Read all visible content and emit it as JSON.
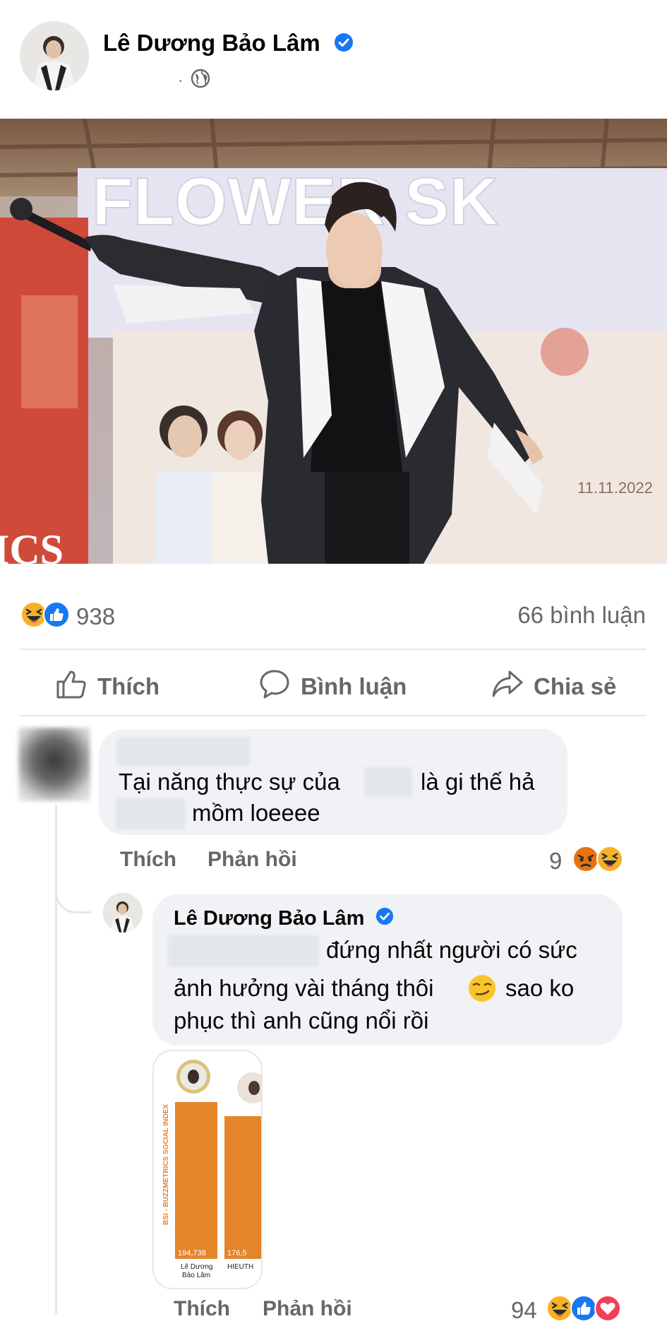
{
  "post": {
    "author": "Lê Dương Bảo Lâm",
    "meta_dot": "·",
    "photo_banner_text": "FLOWER SK",
    "photo_date_text": "11.11.2022",
    "photo_side_text": "ICS"
  },
  "stats": {
    "reaction_count": "938",
    "comment_count": "66 bình luận"
  },
  "actions": {
    "like": "Thích",
    "comment": "Bình luận",
    "share": "Chia sẻ"
  },
  "comment1": {
    "line1_a": "Tại năng thực sự của",
    "line1_b": "là gi thế hả",
    "line2": "mồm loeeee",
    "like_label": "Thích",
    "reply_label": "Phản hồi",
    "reaction_count": "9"
  },
  "reply": {
    "author": "Lê Dương Bảo Lâm",
    "line1": "đứng nhất người có sức",
    "line2_a": "ảnh hưởng vài tháng thôi",
    "line2_b": "sao ko",
    "line3": "phục thì anh cũng nổi rồi",
    "like_label": "Thích",
    "reply_label": "Phản hồi",
    "reaction_count": "94"
  },
  "attachment": {
    "axis_label": "BSI - BUZZMETRICS SOCIAL INDEX",
    "bar1_value": "194,738",
    "bar2_value": "176,5",
    "bar1_name_line1": "Lê Dương",
    "bar1_name_line2": "Bảo Lâm",
    "bar2_name": "HIEUTH"
  },
  "colors": {
    "facebook_blue": "#1877f2",
    "text_secondary": "#65676b",
    "bubble_bg": "#f0f2f5",
    "divider": "#e4e6eb",
    "bar_orange": "#e5852a"
  },
  "icons": [
    "verified-badge-icon",
    "globe-icon",
    "haha-icon",
    "like-icon",
    "thumbs-up-icon",
    "comment-icon",
    "share-icon",
    "angry-icon",
    "love-icon",
    "smirk-emoji-icon"
  ]
}
